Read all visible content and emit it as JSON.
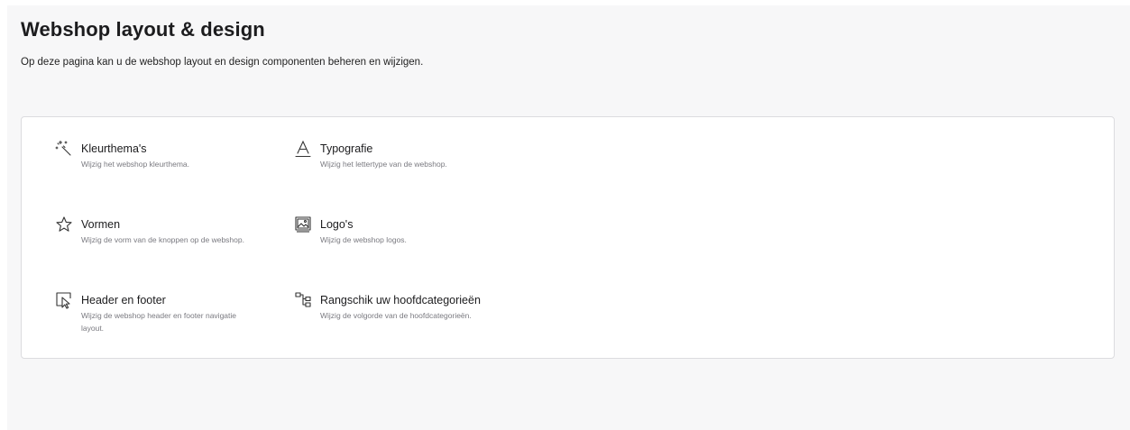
{
  "header": {
    "title": "Webshop layout & design",
    "subtitle": "Op deze pagina kan u de webshop layout en design componenten beheren en wijzigen."
  },
  "settings": {
    "items": [
      {
        "label": "Kleurthema's",
        "description": "Wijzig het webshop kleurthema.",
        "icon": "magic-wand-icon"
      },
      {
        "label": "Typografie",
        "description": "Wijzig het lettertype van de webshop.",
        "icon": "typography-icon"
      },
      {
        "label": "Vormen",
        "description": "Wijzig de vorm van de knoppen op de webshop.",
        "icon": "star-icon"
      },
      {
        "label": "Logo's",
        "description": "Wijzig de webshop logos.",
        "icon": "image-icon"
      },
      {
        "label": "Header en footer",
        "description": "Wijzig de webshop header en footer navigatie layout.",
        "icon": "layout-cursor-icon"
      },
      {
        "label": "Rangschik uw hoofdcategorieën",
        "description": "Wijzig de volgorde van de hoofdcategorieën.",
        "icon": "hierarchy-icon"
      }
    ]
  }
}
